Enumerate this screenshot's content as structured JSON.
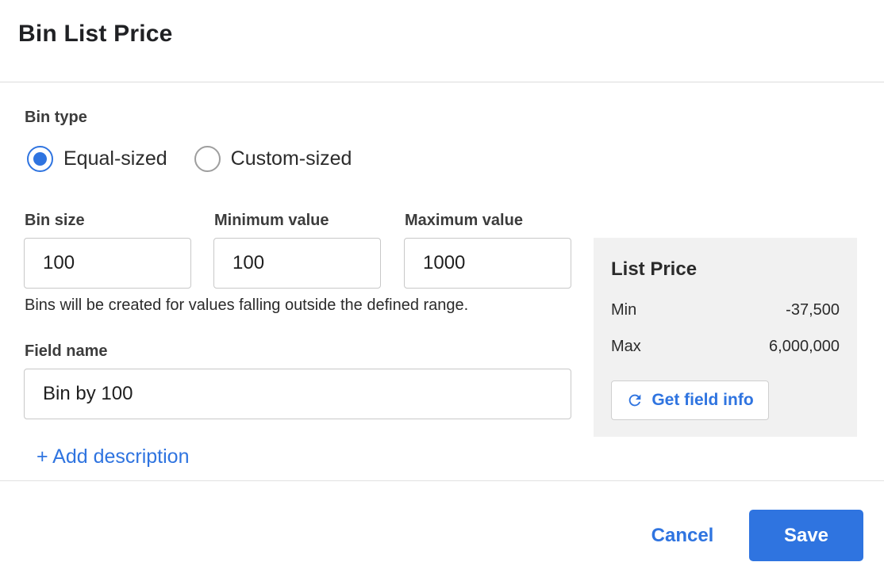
{
  "dialog": {
    "title": "Bin List Price"
  },
  "bin_type": {
    "label": "Bin type",
    "options": [
      {
        "label": "Equal-sized",
        "selected": true
      },
      {
        "label": "Custom-sized",
        "selected": false
      }
    ]
  },
  "bin_size": {
    "label": "Bin size",
    "value": "100"
  },
  "minimum_value": {
    "label": "Minimum value",
    "value": "100"
  },
  "maximum_value": {
    "label": "Maximum value",
    "value": "1000"
  },
  "hint": "Bins will be created for values falling outside the defined range.",
  "field_name": {
    "label": "Field name",
    "value": "Bin by 100"
  },
  "add_description": "+ Add description",
  "field_info": {
    "title": "List Price",
    "min_label": "Min",
    "min_value": "-37,500",
    "max_label": "Max",
    "max_value": "6,000,000",
    "button_label": "Get field info",
    "button_icon": "refresh-icon"
  },
  "footer": {
    "cancel_label": "Cancel",
    "save_label": "Save"
  },
  "colors": {
    "accent": "#2f74e0",
    "panel_bg": "#f1f1f1"
  }
}
